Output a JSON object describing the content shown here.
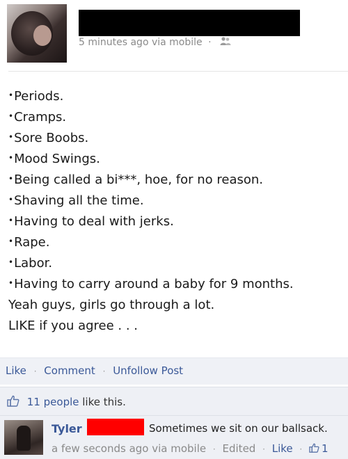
{
  "post": {
    "meta": {
      "time": "5 minutes ago via mobile",
      "dot": "·"
    },
    "lines": [
      "Periods.",
      "Cramps.",
      "Sore Boobs.",
      "Mood Swings.",
      "Being called a bi***, hoe, for no reason.",
      "Shaving all the time.",
      "Having to deal with jerks.",
      "Rape.",
      "Labor.",
      "Having to carry around a baby for 9 months."
    ],
    "bullet": "•",
    "closing": [
      "Yeah guys, girls go through a lot.",
      "LIKE if you agree . . ."
    ]
  },
  "actions": {
    "like": "Like",
    "comment": "Comment",
    "unfollow": "Unfollow Post",
    "sep": "·"
  },
  "likes": {
    "count_link": "11 people",
    "suffix": " like this."
  },
  "comment": {
    "author": "Tyler",
    "text": "Sometimes we sit on our ballsack.",
    "time": "a few seconds ago via mobile",
    "edited": "Edited",
    "like": "Like",
    "like_count": "1",
    "sep": "·"
  },
  "colors": {
    "link": "#3b5998",
    "redaction_black": "#000000",
    "redaction_red": "#ff0000",
    "bar_bg": "#eff1f6"
  },
  "icons": {
    "audience": "friends-icon",
    "like": "thumbs-up-icon"
  }
}
